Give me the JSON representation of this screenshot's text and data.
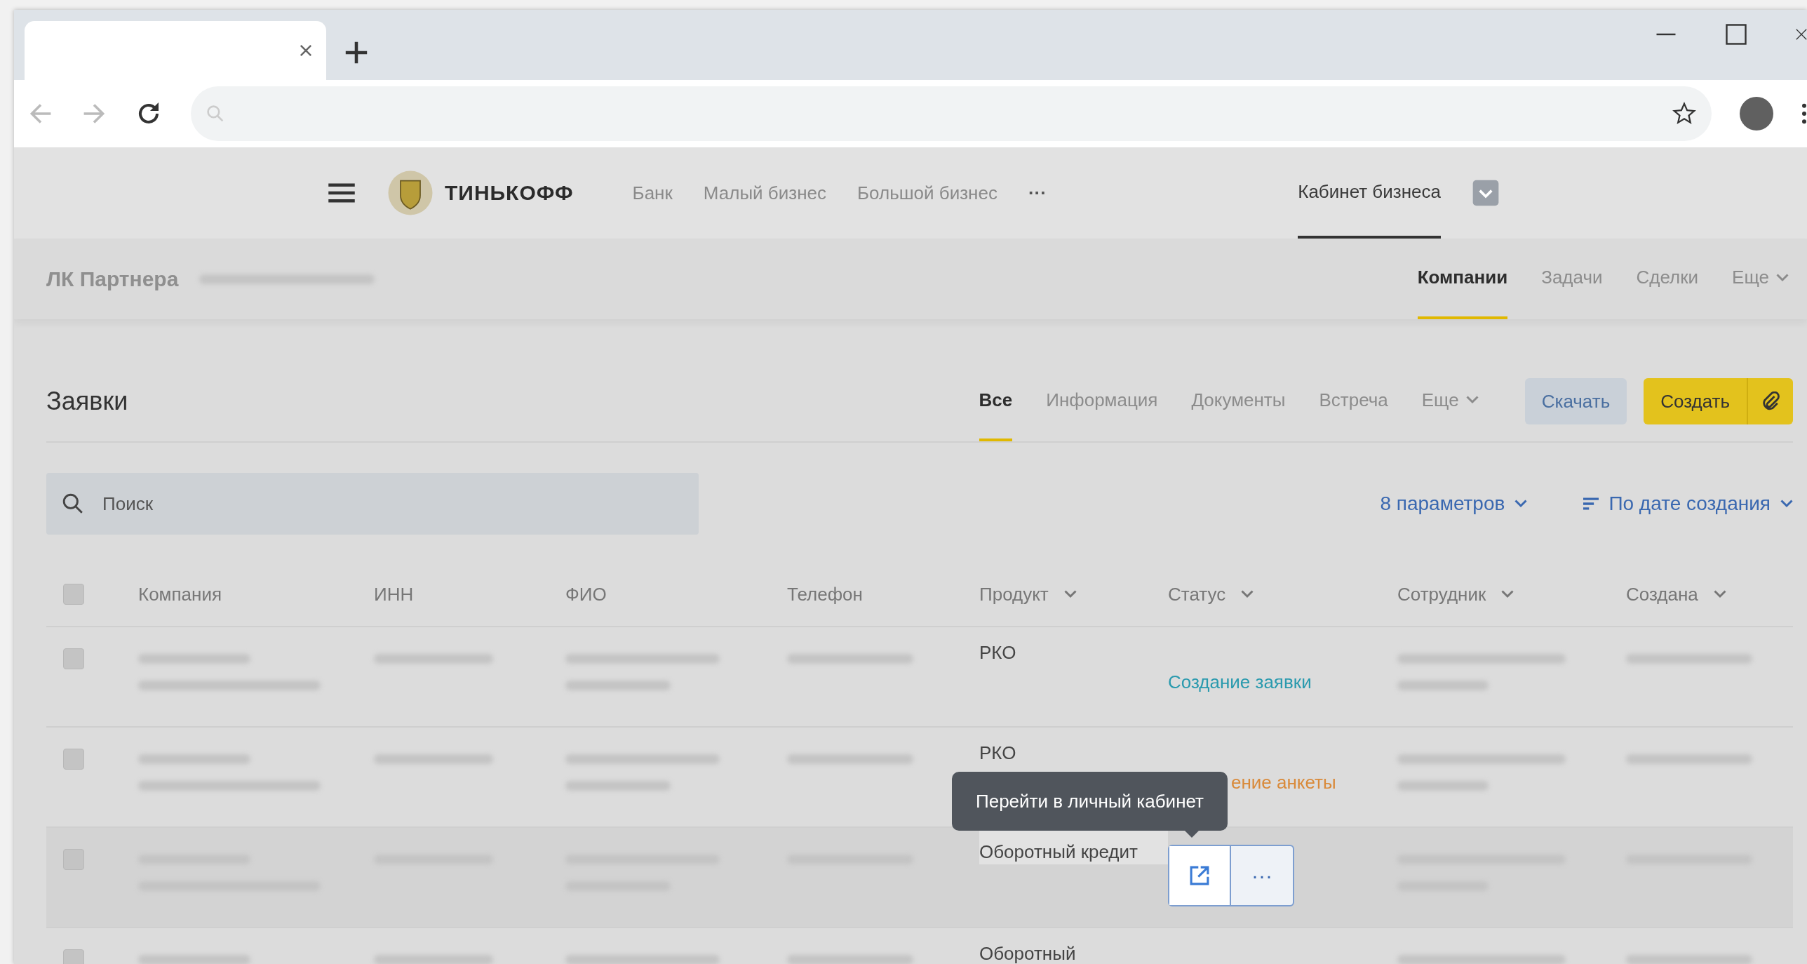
{
  "header": {
    "logo": "ТИНЬКОФФ",
    "nav": [
      {
        "label": "Банк",
        "selected": false
      },
      {
        "label": "Малый бизнес",
        "selected": false
      },
      {
        "label": "Большой бизнес",
        "selected": false
      }
    ],
    "more": "···",
    "cabinet": {
      "label": "Кабинет бизнеса",
      "selected": true
    }
  },
  "partner_bar": {
    "title": "ЛК Партнера",
    "tabs": [
      {
        "label": "Компании",
        "selected": true,
        "kind": "tab"
      },
      {
        "label": "Задачи",
        "selected": false,
        "kind": "tab"
      },
      {
        "label": "Сделки",
        "selected": false,
        "kind": "tab"
      },
      {
        "label": "Еще",
        "selected": false,
        "kind": "menu"
      }
    ]
  },
  "section": {
    "title": "Заявки",
    "tabs": [
      {
        "label": "Все",
        "selected": true,
        "kind": "tab"
      },
      {
        "label": "Информация",
        "selected": false,
        "kind": "tab"
      },
      {
        "label": "Документы",
        "selected": false,
        "kind": "tab"
      },
      {
        "label": "Встреча",
        "selected": false,
        "kind": "tab"
      },
      {
        "label": "Еще",
        "selected": false,
        "kind": "menu"
      }
    ],
    "download": "Скачать",
    "create": "Создать"
  },
  "search": {
    "placeholder": "Поиск"
  },
  "filters": "8 параметров",
  "sort": "По дате создания",
  "table": {
    "select_all_checked": false,
    "columns": [
      {
        "label": "Компания",
        "filter": false
      },
      {
        "label": "ИНН",
        "filter": false
      },
      {
        "label": "ФИО",
        "filter": false
      },
      {
        "label": "Телефон",
        "filter": false
      },
      {
        "label": "Продукт",
        "filter": true
      },
      {
        "label": "Статус",
        "filter": true
      },
      {
        "label": "Сотрудник",
        "filter": true
      },
      {
        "label": "Создана",
        "filter": true
      }
    ],
    "rows": [
      {
        "checked": false,
        "hovered": false,
        "product": "РКО",
        "status": {
          "text": "Создание заявки",
          "color": "#2a9aae",
          "obscured": false
        }
      },
      {
        "checked": false,
        "hovered": false,
        "product": "РКО",
        "status": {
          "text": "ение анкеты",
          "color": "#d98a3a",
          "obscured": true
        }
      },
      {
        "checked": false,
        "hovered": true,
        "product": "Оборотный кредит",
        "actions": {
          "tooltip": "Перейти в личный кабинет",
          "more": "···"
        }
      },
      {
        "checked": false,
        "hovered": false,
        "product": "Оборотный"
      }
    ]
  }
}
